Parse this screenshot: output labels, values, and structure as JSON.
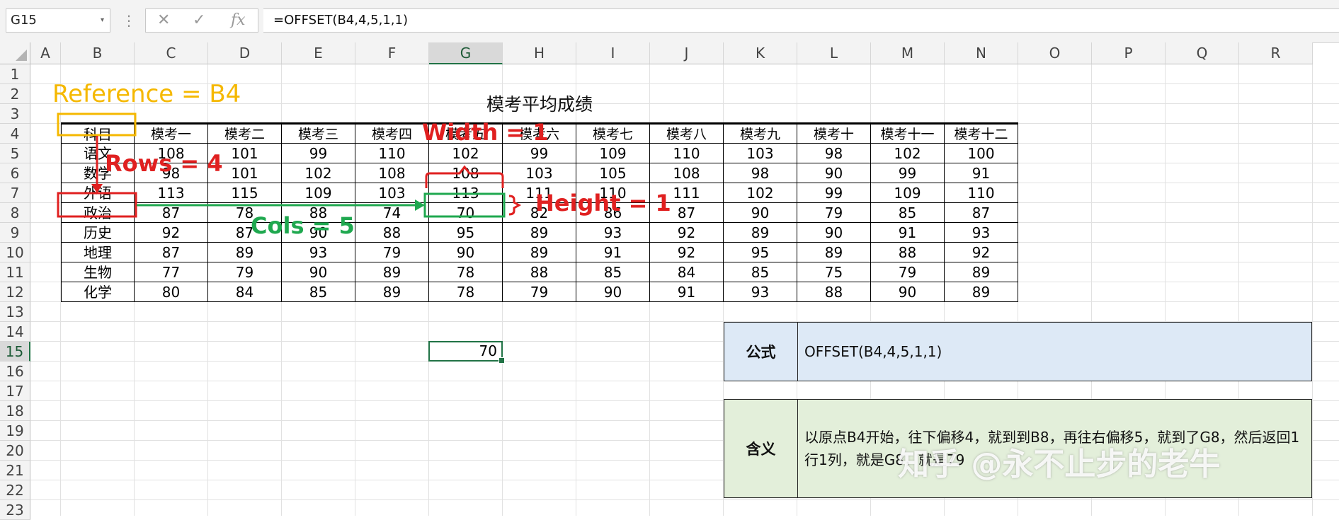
{
  "formula_bar": {
    "name_box": "G15",
    "dropdown_icon": "▾",
    "dots": "⋮",
    "cancel_icon": "✕",
    "enter_icon": "✓",
    "function_icon": "fx",
    "formula": "=OFFSET(B4,4,5,1,1)"
  },
  "columns": [
    "A",
    "B",
    "C",
    "D",
    "E",
    "F",
    "G",
    "H",
    "I",
    "J",
    "K",
    "L",
    "M",
    "N",
    "O",
    "P",
    "Q",
    "R"
  ],
  "rows": [
    "1",
    "2",
    "3",
    "4",
    "5",
    "6",
    "7",
    "8",
    "9",
    "10",
    "11",
    "12",
    "13",
    "14",
    "15",
    "16",
    "17",
    "18",
    "19",
    "20",
    "21",
    "22",
    "23"
  ],
  "selected_column": "G",
  "selected_row": "15",
  "table": {
    "title": "模考平均成绩",
    "header": [
      "科目",
      "模考一",
      "模考二",
      "模考三",
      "模考四",
      "模考五",
      "模考六",
      "模考七",
      "模考八",
      "模考九",
      "模考十",
      "模考十一",
      "模考十二"
    ],
    "rows": [
      [
        "语文",
        "108",
        "101",
        "99",
        "110",
        "102",
        "99",
        "109",
        "110",
        "103",
        "98",
        "102",
        "100"
      ],
      [
        "数学",
        "98",
        "101",
        "102",
        "108",
        "108",
        "103",
        "105",
        "108",
        "98",
        "90",
        "99",
        "91"
      ],
      [
        "外语",
        "113",
        "115",
        "109",
        "103",
        "113",
        "111",
        "110",
        "111",
        "102",
        "99",
        "109",
        "110"
      ],
      [
        "政治",
        "87",
        "78",
        "88",
        "74",
        "70",
        "82",
        "86",
        "87",
        "90",
        "79",
        "85",
        "87"
      ],
      [
        "历史",
        "92",
        "87",
        "90",
        "88",
        "95",
        "89",
        "93",
        "92",
        "89",
        "90",
        "91",
        "93"
      ],
      [
        "地理",
        "87",
        "89",
        "93",
        "79",
        "90",
        "89",
        "91",
        "92",
        "95",
        "89",
        "88",
        "92"
      ],
      [
        "生物",
        "77",
        "79",
        "90",
        "89",
        "78",
        "88",
        "85",
        "84",
        "85",
        "75",
        "79",
        "89"
      ],
      [
        "化学",
        "80",
        "84",
        "85",
        "89",
        "78",
        "79",
        "90",
        "91",
        "93",
        "88",
        "90",
        "89"
      ]
    ]
  },
  "result_cell": {
    "ref": "G15",
    "value": "70"
  },
  "info": {
    "formula_label": "公式",
    "formula_value": "OFFSET(B4,4,5,1,1)",
    "meaning_label": "含义",
    "meaning_value": "以原点B4开始，往下偏移4，就到到B8，再往右偏移5，就到了G8，然后返回1行1列，就是G8，就是79"
  },
  "annotations": {
    "reference": "Reference = B4",
    "rows": "Rows = 4",
    "cols": "Cols = 5",
    "width": "Width = 1",
    "height": "Height = 1"
  },
  "watermark": "知乎 @永不止步的老牛",
  "colors": {
    "reference": "#f5b800",
    "rows_red": "#e02020",
    "cols_green": "#1fa84f",
    "excel_green": "#217346",
    "formula_box_bg": "#dde9f6",
    "meaning_box_bg": "#e3efda"
  }
}
